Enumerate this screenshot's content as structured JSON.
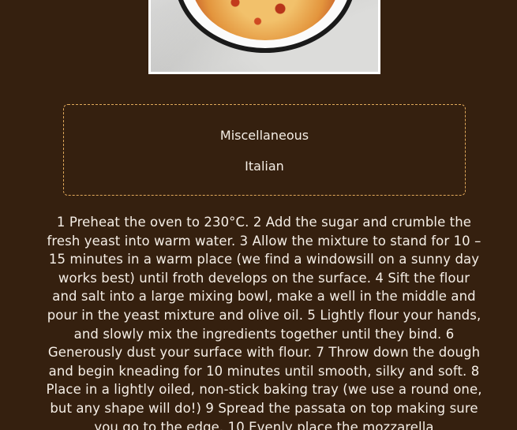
{
  "recipe": {
    "category": "Miscellaneous",
    "cuisine": "Italian",
    "instructions": "1 Preheat the oven to 230°C. 2 Add the sugar and crumble the fresh yeast into warm water. 3 Allow the mixture to stand for 10 – 15 minutes in a warm place (we find a windowsill on a sunny day works best) until froth develops on the surface. 4 Sift the flour and salt into a large mixing bowl, make a well in the middle and pour in the yeast mixture and olive oil. 5 Lightly flour your hands, and slowly mix the ingredients together until they bind. 6 Generously dust your surface with flour. 7 Throw down the dough and begin kneading for 10 minutes until smooth, silky and soft. 8 Place in a lightly oiled, non-stick baking tray (we use a round one, but any shape will do!) 9 Spread the passata on top making sure you go to the edge. 10 Evenly place the mozzarella"
  },
  "colors": {
    "background": "#35200f",
    "tag_border": "#e0a85a",
    "text": "#f5eee6"
  }
}
